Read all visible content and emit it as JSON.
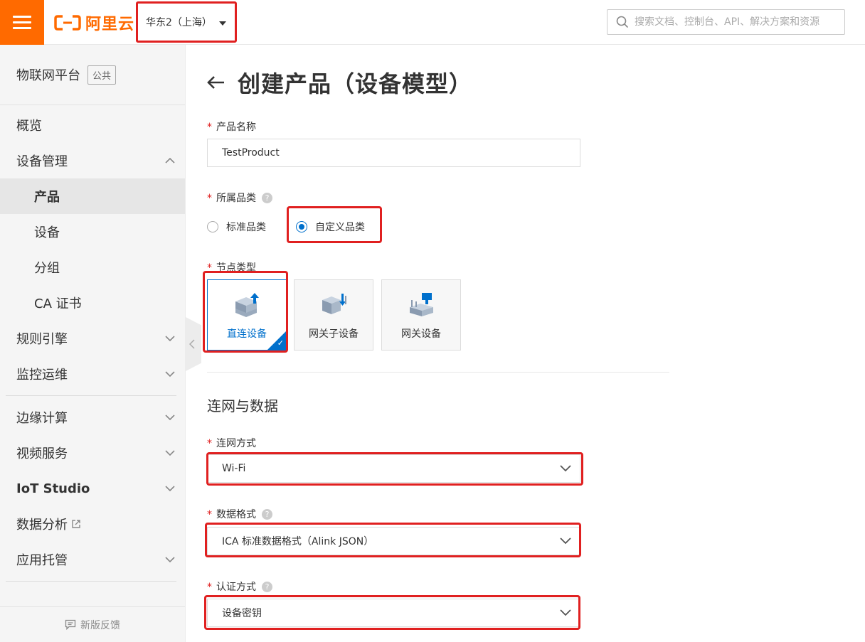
{
  "topbar": {
    "logo_text": "阿里云",
    "region": "华东2（上海）",
    "search_placeholder": "搜索文档、控制台、API、解决方案和资源"
  },
  "sidebar": {
    "title": "物联网平台",
    "tag": "公共",
    "items": [
      {
        "label": "概览"
      },
      {
        "label": "设备管理",
        "expanded": true
      },
      {
        "label": "产品",
        "active": true
      },
      {
        "label": "设备"
      },
      {
        "label": "分组"
      },
      {
        "label": "CA 证书"
      },
      {
        "label": "规则引擎"
      },
      {
        "label": "监控运维"
      },
      {
        "label": "边缘计算"
      },
      {
        "label": "视频服务"
      },
      {
        "label": "IoT Studio"
      },
      {
        "label": "数据分析"
      },
      {
        "label": "应用托管"
      }
    ],
    "feedback": "新版反馈"
  },
  "page": {
    "title": "创建产品（设备模型）",
    "product_name": {
      "label": "产品名称",
      "value": "TestProduct"
    },
    "category": {
      "label": "所属品类",
      "options": [
        "标准品类",
        "自定义品类"
      ],
      "selected": "自定义品类"
    },
    "node_type": {
      "label": "节点类型",
      "options": [
        "直连设备",
        "网关子设备",
        "网关设备"
      ],
      "selected": "直连设备"
    },
    "section_title": "连网与数据",
    "network": {
      "label": "连网方式",
      "value": "Wi-Fi"
    },
    "data_format": {
      "label": "数据格式",
      "value": "ICA 标准数据格式（Alink JSON）"
    },
    "auth": {
      "label": "认证方式",
      "value": "设备密钥"
    }
  },
  "colors": {
    "brand": "#ff6a00",
    "accent": "#0070cc",
    "highlight": "#e02020"
  }
}
